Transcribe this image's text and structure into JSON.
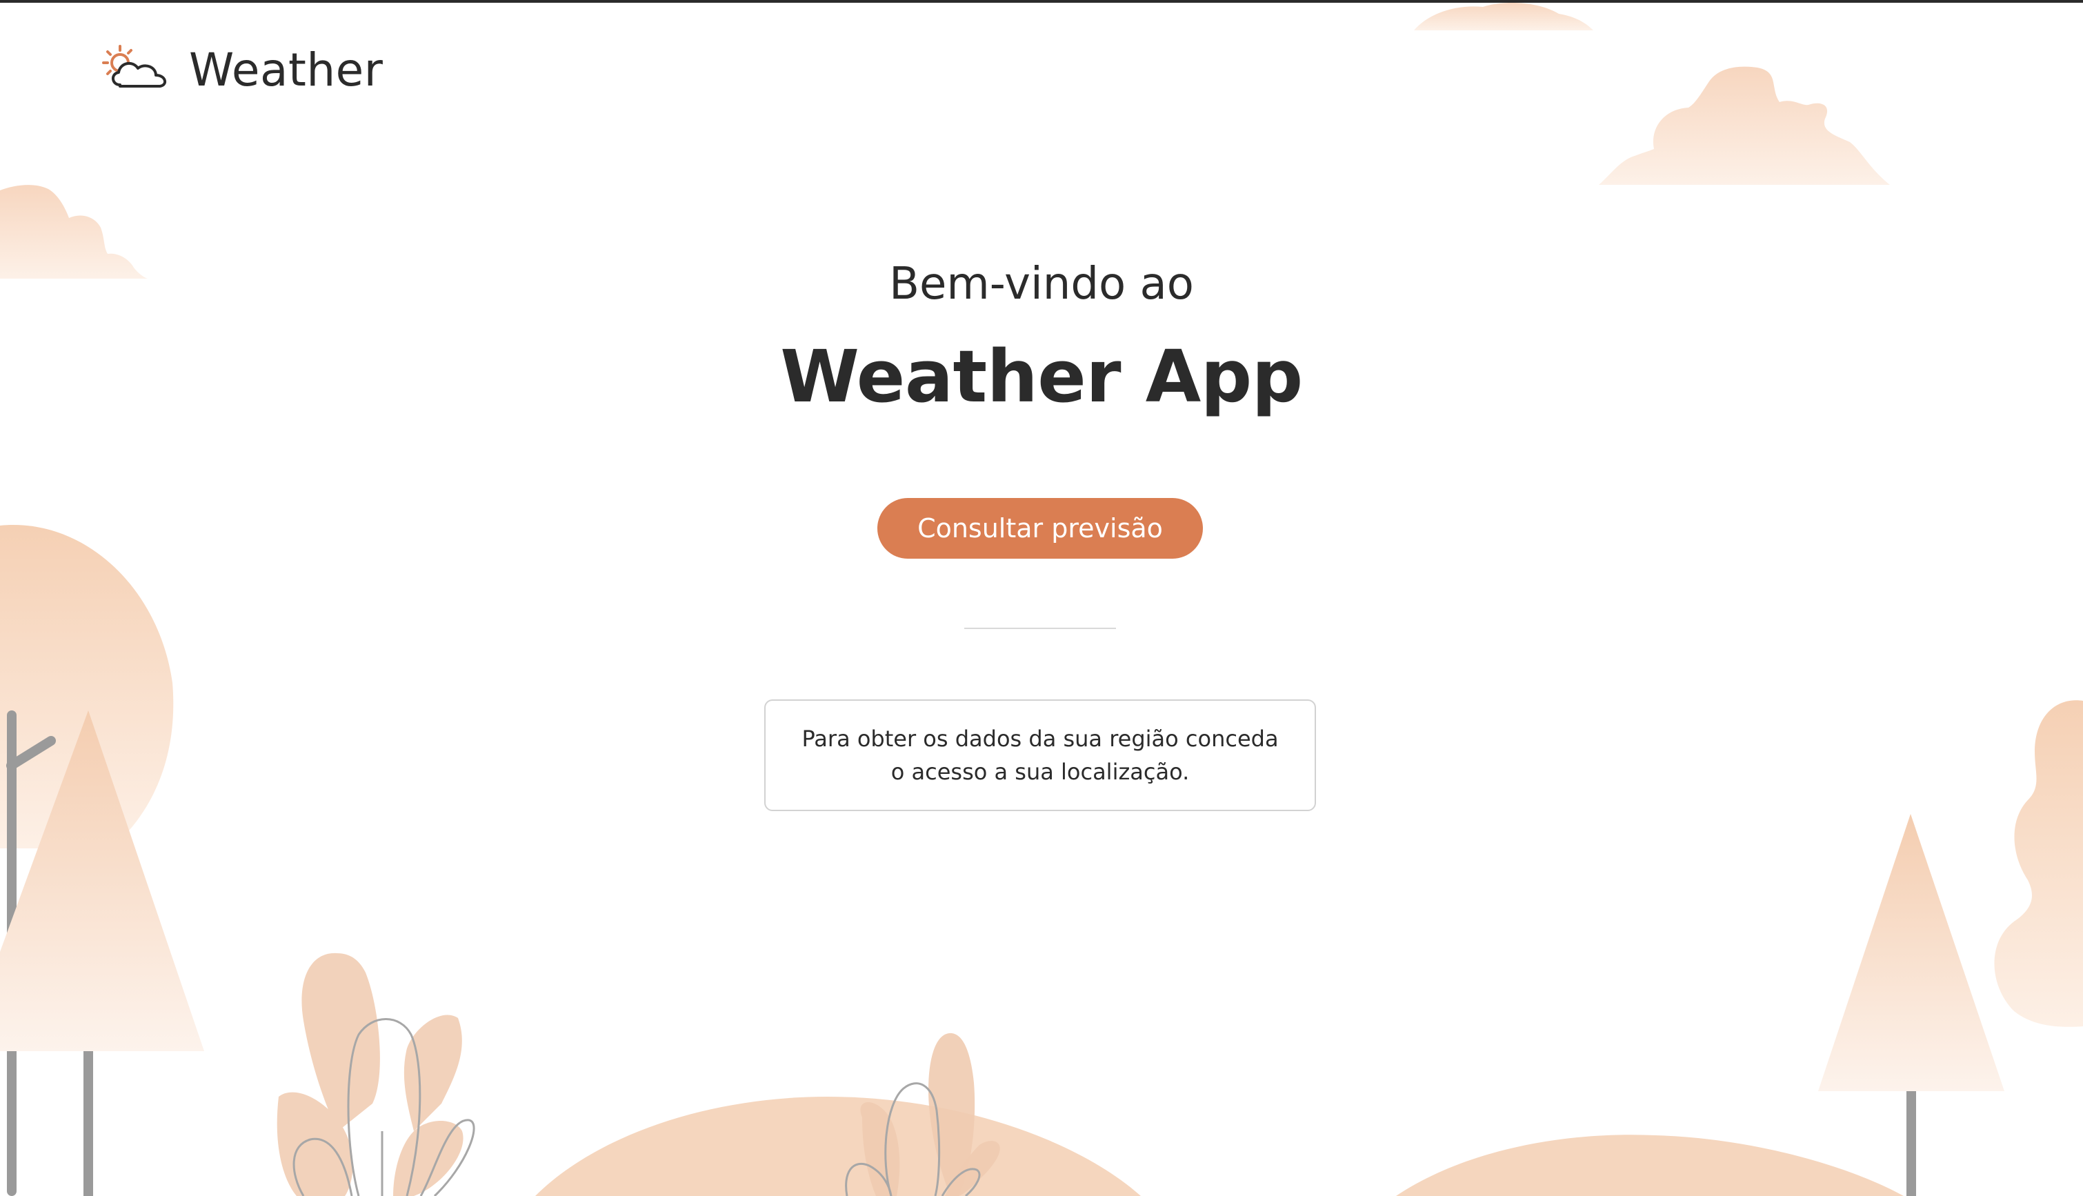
{
  "header": {
    "logo_text": "Weather",
    "logo_icon": "sun-cloud-icon"
  },
  "hero": {
    "subtitle": "Bem-vindo ao",
    "title": "Weather App",
    "cta_label": "Consultar previsão"
  },
  "notice": {
    "text_line1": "Para obter os dados da sua região conceda",
    "text_line2": "o acesso a sua localização."
  },
  "colors": {
    "accent": "#da7e52",
    "text": "#2b2b2b",
    "scenery_peach": "#f5d3b8",
    "trunk_gray": "#9a9a9a"
  }
}
